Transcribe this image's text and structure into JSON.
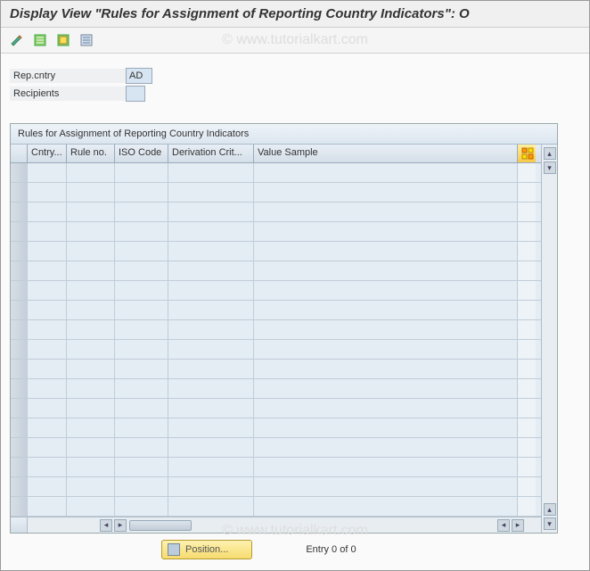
{
  "header": {
    "title": "Display View \"Rules for Assignment of Reporting Country Indicators\": O"
  },
  "watermark": "© www.tutorialkart.com",
  "toolbar": {
    "icons": [
      "change-icon",
      "table-select-icon",
      "table-filter-icon",
      "table-settings-icon"
    ]
  },
  "form": {
    "rep_country_label": "Rep.cntry",
    "rep_country_value": "AD",
    "recipients_label": "Recipients",
    "recipients_value": ""
  },
  "table": {
    "title": "Rules for Assignment of Reporting Country Indicators",
    "columns": [
      "Cntry...",
      "Rule no.",
      "ISO Code",
      "Derivation Crit...",
      "Value Sample"
    ],
    "config_icon": "table-config-icon",
    "rows": 18
  },
  "footer": {
    "position_label": "Position...",
    "entry_text": "Entry 0 of 0"
  }
}
